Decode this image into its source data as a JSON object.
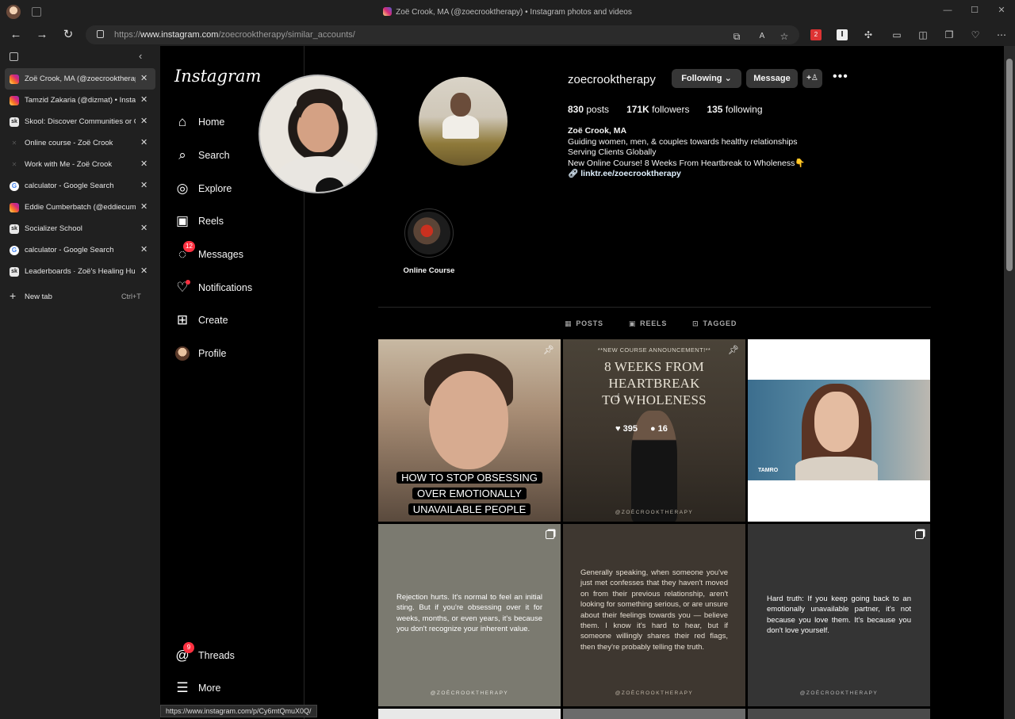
{
  "window": {
    "title": "Zoë Crook, MA (@zoecrooktherapy) • Instagram photos and videos"
  },
  "address_bar": {
    "prefix": "https://",
    "domain": "www.instagram.com",
    "path": "/zoecrooktherapy/similar_accounts/"
  },
  "toolbar": {
    "extension_badge": "2"
  },
  "tabs": [
    {
      "favicon": "instagram",
      "label": "Zoë Crook, MA (@zoecrooktherapy",
      "active": true
    },
    {
      "favicon": "instagram",
      "label": "Tamzid Zakaria (@dizmat) • Instagra",
      "active": false
    },
    {
      "favicon": "skool",
      "label": "Skool: Discover Communities or Cre",
      "active": false
    },
    {
      "favicon": "x",
      "label": "Online course - Zoë Crook",
      "active": false
    },
    {
      "favicon": "x",
      "label": "Work with Me - Zoë Crook",
      "active": false
    },
    {
      "favicon": "google",
      "label": "calculator - Google Search",
      "active": false
    },
    {
      "favicon": "instagram",
      "label": "Eddie Cumberbatch (@eddiecumbe",
      "active": false
    },
    {
      "favicon": "skool",
      "label": "Socializer School",
      "active": false
    },
    {
      "favicon": "google",
      "label": "calculator - Google Search",
      "active": false
    },
    {
      "favicon": "skool",
      "label": "Leaderboards · Zoë's Healing Hub",
      "active": false
    }
  ],
  "new_tab": {
    "label": "New tab",
    "shortcut": "Ctrl+T"
  },
  "instagram": {
    "logo": "Instagram",
    "nav": [
      {
        "label": "Home",
        "icon": "home-icon"
      },
      {
        "label": "Search",
        "icon": "search-icon"
      },
      {
        "label": "Explore",
        "icon": "compass-icon"
      },
      {
        "label": "Reels",
        "icon": "reels-icon"
      },
      {
        "label": "Messages",
        "icon": "messenger-icon",
        "badge": "12"
      },
      {
        "label": "Notifications",
        "icon": "heart-icon"
      },
      {
        "label": "Create",
        "icon": "plus-square-icon"
      },
      {
        "label": "Profile",
        "icon": "avatar"
      }
    ],
    "threads": {
      "label": "Threads",
      "badge": "9"
    },
    "more": {
      "label": "More"
    }
  },
  "profile": {
    "username": "zoecrooktherapy",
    "following_button": "Following",
    "message_button": "Message",
    "posts_count": "830",
    "posts_label": "posts",
    "followers_count": "171K",
    "followers_label": "followers",
    "following_count": "135",
    "following_label": "following",
    "name": "Zoë Crook, MA",
    "bio_line1": "Guiding women, men, & couples towards healthy relationships",
    "bio_line2": "Serving Clients Globally",
    "bio_line3": "New Online Course! 8 Weeks From Heartbreak to Wholeness👇",
    "link": "linktr.ee/zoecrooktherapy",
    "highlight": "Online Course"
  },
  "profile_tabs": [
    "POSTS",
    "REELS",
    "TAGGED"
  ],
  "posts": {
    "p1_caption_l1": "HOW TO STOP OBSESSING",
    "p1_caption_l2": "OVER EMOTIONALLY",
    "p1_caption_l3": "UNAVAILABLE PEOPLE",
    "p2_announce": "**NEW COURSE ANNOUNCEMENT!**",
    "p2_title_l1": "8 WEEKS FROM HEARTBREAK",
    "p2_title_l2": "TO WHOLENESS",
    "p2_likes": "395",
    "p2_comments": "16",
    "handle": "@ZOËCROOKTHERAPY",
    "p3_tag": "TAMRO",
    "p4_text": "Rejection hurts. It's normal to feel an initial sting. But if you're obsessing over it for weeks, months, or even years, it's because you don't recognize your inherent value.",
    "p5_text": "Generally speaking, when someone you've just met confesses that they haven't moved on from their previous relationship, aren't looking for something serious, or are unsure about their feelings towards you — believe them. I know it's hard to hear, but if someone willingly shares their red flags, then they're probably telling the truth.",
    "p6_text": "Hard truth: If you keep going back to an emotionally unavailable partner, it's not because you love them. It's because you don't love yourself."
  },
  "status_url": "https://www.instagram.com/p/Cy6mtQmuX0Q/"
}
